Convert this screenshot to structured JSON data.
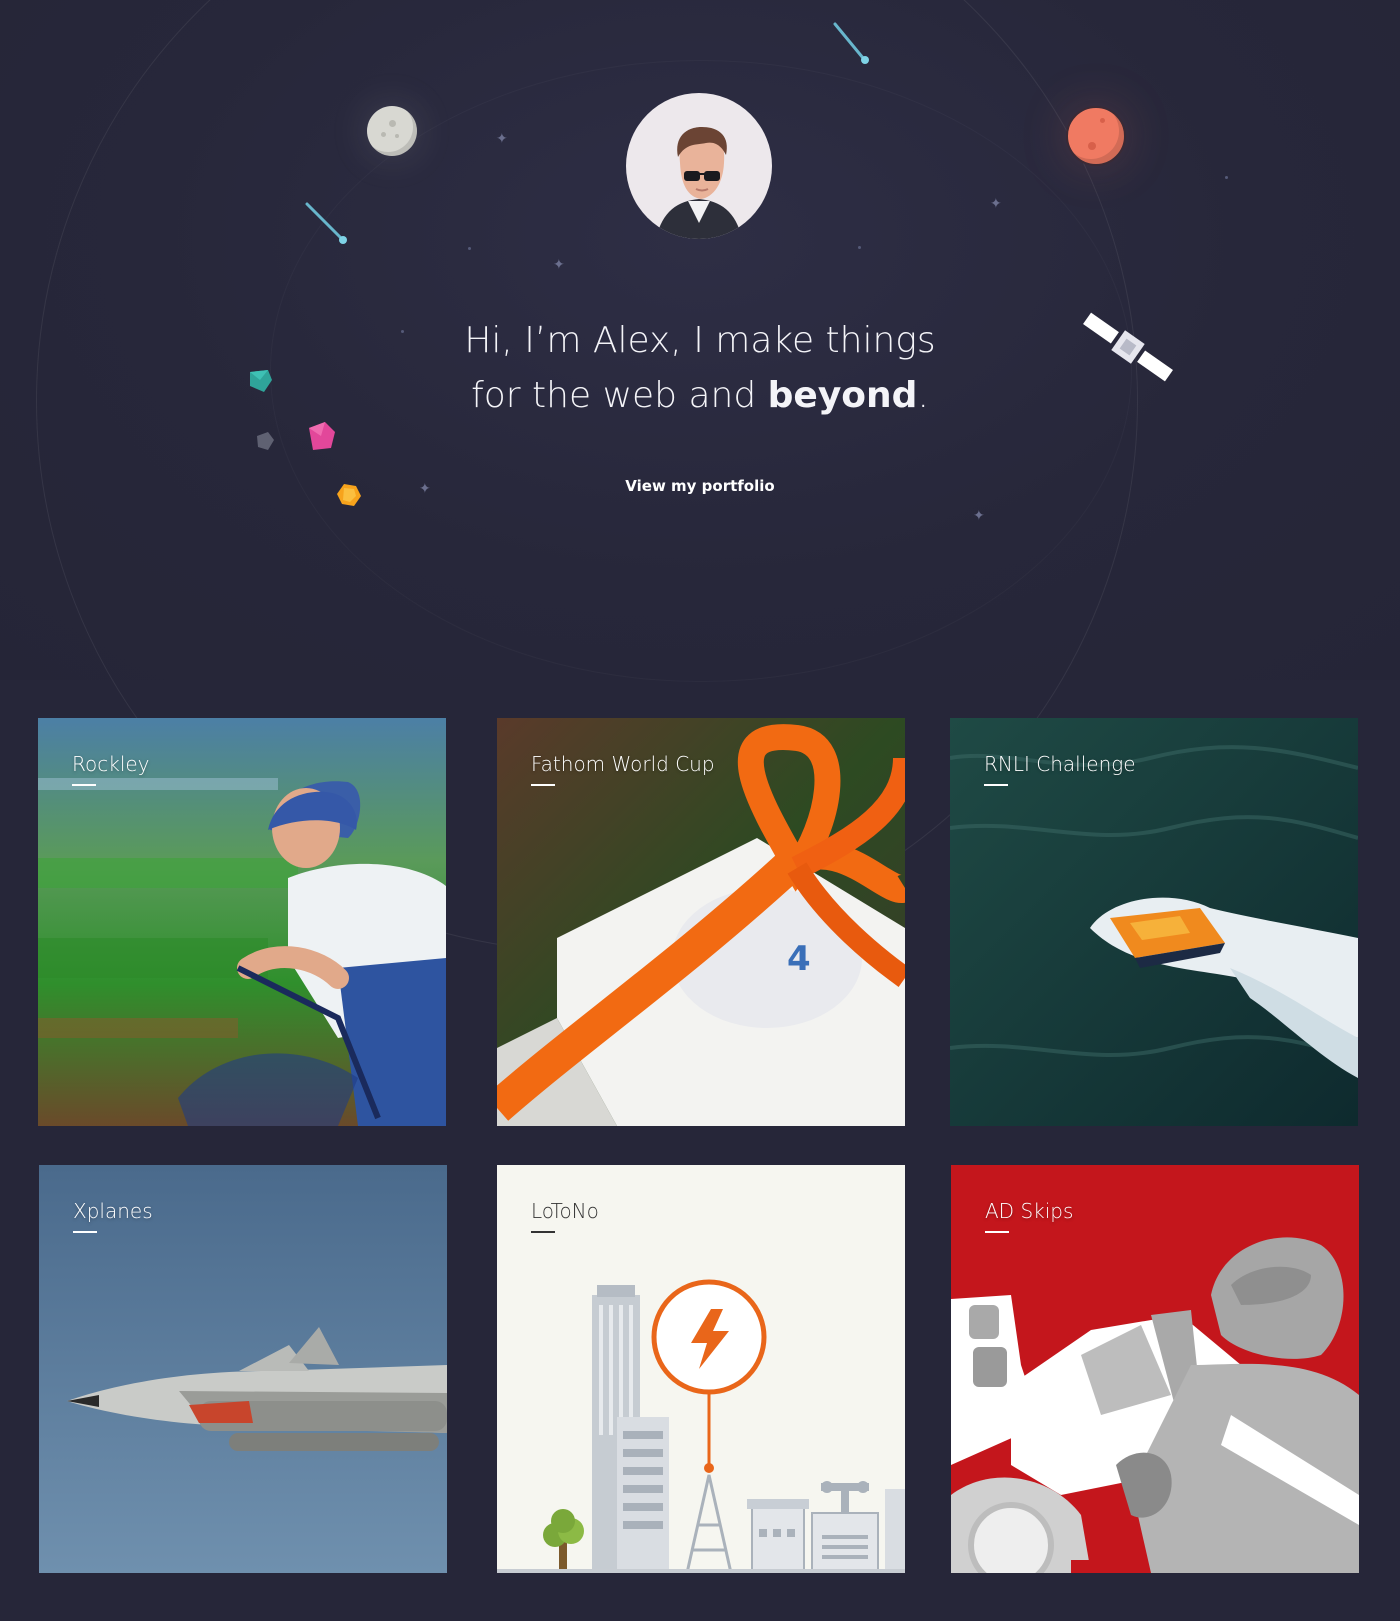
{
  "hero": {
    "headline_line1": "Hi, I’m Alex, I make things",
    "headline_line2_prefix": "for the web and ",
    "headline_emphasis": "beyond",
    "headline_suffix": ".",
    "cta_label": "View my portfolio"
  },
  "portfolio": {
    "items": [
      {
        "title": "Rockley"
      },
      {
        "title": "Fathom World Cup"
      },
      {
        "title": "RNLI Challenge"
      },
      {
        "title": "Xplanes"
      },
      {
        "title": "LoToNo"
      },
      {
        "title": "AD Skips"
      }
    ]
  },
  "colors": {
    "background": "#262639",
    "accent_orange": "#f07a1a",
    "skips_red": "#c4161c",
    "planet_mars": "#f07a62"
  }
}
